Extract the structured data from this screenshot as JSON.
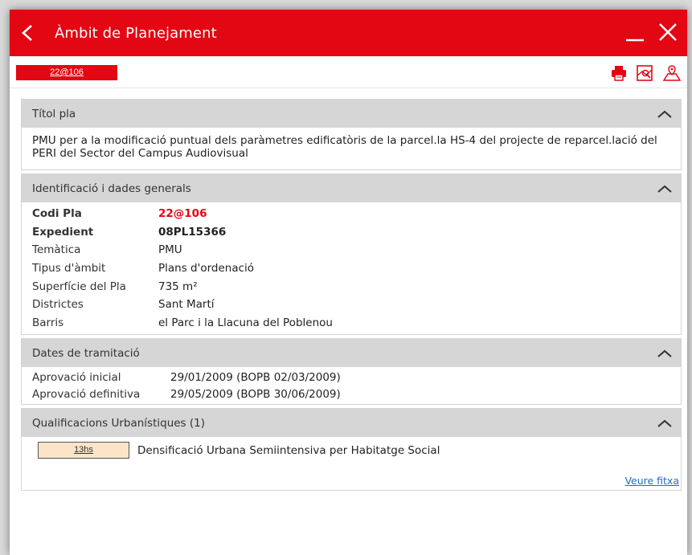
{
  "window": {
    "title": "Àmbit de Planejament"
  },
  "code_badge": "22@106",
  "sections": {
    "titol": {
      "title": "Títol pla",
      "text": "PMU per a la modificació puntual dels paràmetres edificatòris de la parcel.la HS-4 del projecte de reparcel.lació del PERI del Sector del Campus Audiovisual"
    },
    "ident": {
      "title": "Identificació i dades generals",
      "rows": [
        {
          "label": "Codi Pla",
          "value": "22@106"
        },
        {
          "label": "Expedient",
          "value": "08PL15366"
        },
        {
          "label": "Temàtica",
          "value": "PMU"
        },
        {
          "label": "Tipus d'àmbit",
          "value": "Plans d'ordenació"
        },
        {
          "label": "Superfície del Pla",
          "value": "735 m²"
        },
        {
          "label": "Districtes",
          "value": "Sant Martí"
        },
        {
          "label": "Barris",
          "value": "el Parc i la Llacuna del Poblenou"
        }
      ]
    },
    "dates": {
      "title": "Dates de tramitació",
      "rows": [
        {
          "label": "Aprovació inicial",
          "value": "29/01/2009 (BOPB 02/03/2009)"
        },
        {
          "label": "Aprovació definitiva",
          "value": "29/05/2009 (BOPB 30/06/2009)"
        }
      ]
    },
    "qual": {
      "title": "Qualificacions Urbanístiques (1)",
      "code": "13hs",
      "description": "Densificació Urbana Semiintensiva per Habitatge Social",
      "link": "Veure fitxa"
    }
  },
  "icons": [
    "back-icon",
    "minimize-icon",
    "close-icon",
    "print-icon",
    "map-zoom-icon",
    "map-location-icon",
    "chevron-up-icon"
  ],
  "colors": {
    "accent": "#e30613",
    "header_gray": "#d6d6d6",
    "badge_beige": "#fbe4c7",
    "link": "#1a6fc2"
  }
}
